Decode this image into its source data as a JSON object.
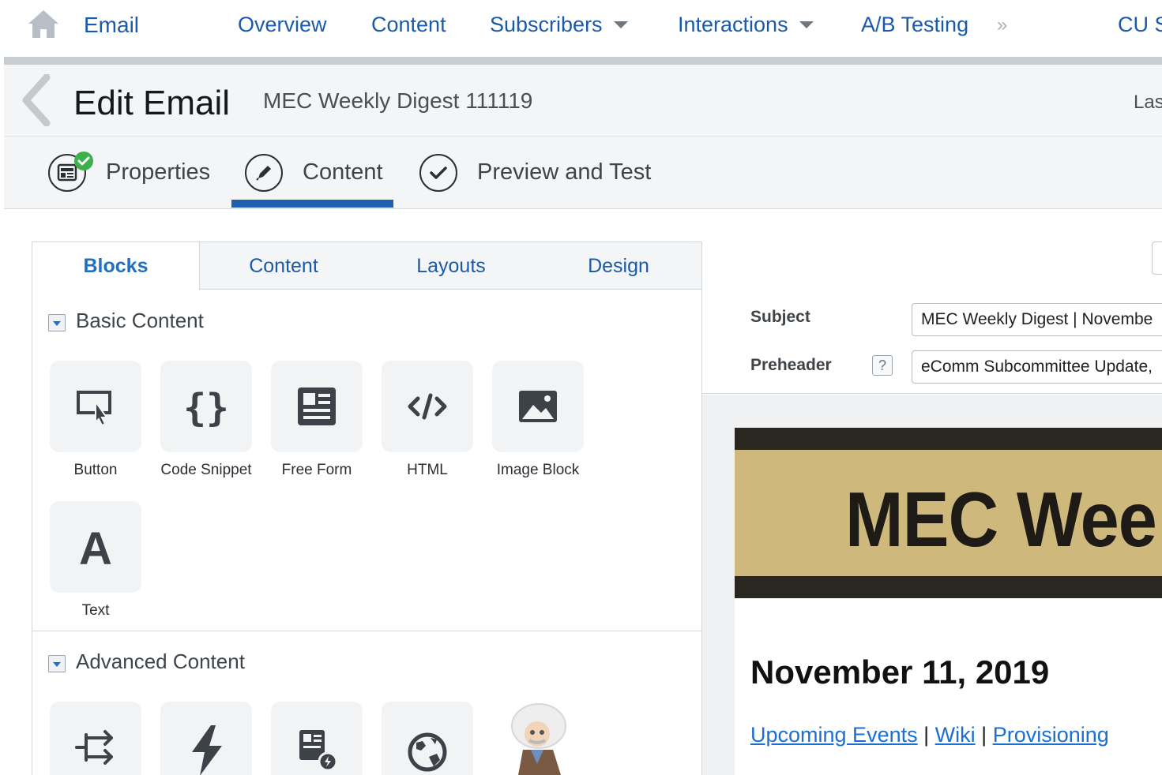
{
  "topnav": {
    "app": "Email",
    "items": [
      "Overview",
      "Content",
      "Subscribers",
      "Interactions",
      "A/B Testing"
    ],
    "more": "»",
    "cut_item": "CU S"
  },
  "header": {
    "title": "Edit Email",
    "subtitle": "MEC Weekly Digest 111119",
    "right_text": "Las"
  },
  "steps": [
    {
      "label": "Properties",
      "icon": "properties-icon",
      "complete": true
    },
    {
      "label": "Content",
      "icon": "pencil-icon",
      "active": true
    },
    {
      "label": "Preview and Test",
      "icon": "checkmark-icon"
    }
  ],
  "panel_tabs": [
    "Blocks",
    "Content",
    "Layouts",
    "Design"
  ],
  "sections": {
    "basic": {
      "label": "Basic Content",
      "blocks": [
        "Button",
        "Code Snippet",
        "Free Form",
        "HTML",
        "Image Block",
        "Text"
      ]
    },
    "advanced": {
      "label": "Advanced Content",
      "icons": [
        "share-arrow-icon",
        "lightning-icon",
        "dynamic-content-icon",
        "globe-icon",
        "einstein-mascot-icon"
      ]
    }
  },
  "fields": {
    "subject_label": "Subject",
    "subject_value": "MEC Weekly Digest | Novembe",
    "preheader_label": "Preheader",
    "preheader_help": "?",
    "preheader_value": "eComm Subcommittee Update,"
  },
  "email": {
    "banner_title": "MEC Wee",
    "date": "November 11, 2019",
    "links": [
      "Upcoming Events",
      "Wiki",
      "Provisioning"
    ],
    "separator": "|"
  },
  "colors": {
    "link_blue": "#1a5aa8",
    "active_tab_bar": "#1f5fb0",
    "banner_gold": "#cfb87c",
    "banner_dark": "#2a2620",
    "complete_green": "#3bb04b"
  }
}
